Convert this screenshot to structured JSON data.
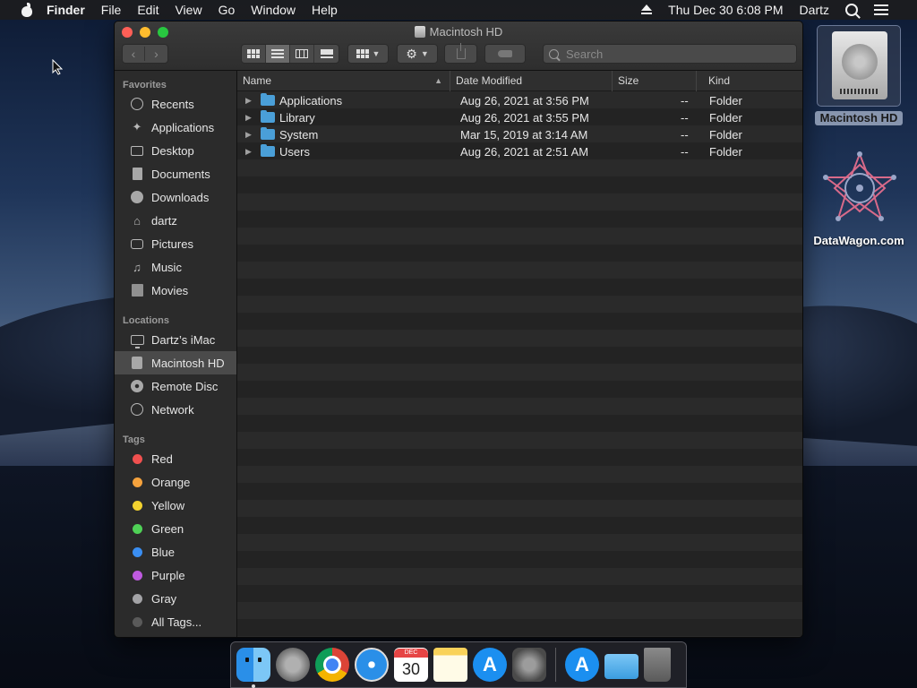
{
  "menubar": {
    "app_name": "Finder",
    "items": [
      "File",
      "Edit",
      "View",
      "Go",
      "Window",
      "Help"
    ],
    "datetime": "Thu Dec 30  6:08 PM",
    "user": "Dartz"
  },
  "window": {
    "title": "Macintosh HD",
    "search_placeholder": "Search"
  },
  "sidebar": {
    "favorites_heading": "Favorites",
    "favorites": [
      {
        "label": "Recents",
        "icon": "clock-icon"
      },
      {
        "label": "Applications",
        "icon": "applications-icon"
      },
      {
        "label": "Desktop",
        "icon": "desktop-icon"
      },
      {
        "label": "Documents",
        "icon": "document-icon"
      },
      {
        "label": "Downloads",
        "icon": "download-icon"
      },
      {
        "label": "dartz",
        "icon": "home-icon"
      },
      {
        "label": "Pictures",
        "icon": "camera-icon"
      },
      {
        "label": "Music",
        "icon": "music-icon"
      },
      {
        "label": "Movies",
        "icon": "film-icon"
      }
    ],
    "locations_heading": "Locations",
    "locations": [
      {
        "label": "Dartz’s iMac",
        "icon": "imac-icon"
      },
      {
        "label": "Macintosh HD",
        "icon": "hard-drive-icon",
        "selected": true
      },
      {
        "label": "Remote Disc",
        "icon": "disc-icon"
      },
      {
        "label": "Network",
        "icon": "globe-icon"
      }
    ],
    "tags_heading": "Tags",
    "tags": [
      {
        "label": "Red",
        "color": "#f0504f"
      },
      {
        "label": "Orange",
        "color": "#f5a23d"
      },
      {
        "label": "Yellow",
        "color": "#f3d22f"
      },
      {
        "label": "Green",
        "color": "#4fd156"
      },
      {
        "label": "Blue",
        "color": "#3a8ef2"
      },
      {
        "label": "Purple",
        "color": "#bf5ae0"
      },
      {
        "label": "Gray",
        "color": "#a3a3a6"
      },
      {
        "label": "All Tags...",
        "color": "#5a5a5a"
      }
    ]
  },
  "columns": {
    "name": "Name",
    "date": "Date Modified",
    "size": "Size",
    "kind": "Kind"
  },
  "files": [
    {
      "name": "Applications",
      "date": "Aug 26, 2021 at 3:56 PM",
      "size": "--",
      "kind": "Folder"
    },
    {
      "name": "Library",
      "date": "Aug 26, 2021 at 3:55 PM",
      "size": "--",
      "kind": "Folder"
    },
    {
      "name": "System",
      "date": "Mar 15, 2019 at 3:14 AM",
      "size": "--",
      "kind": "Folder"
    },
    {
      "name": "Users",
      "date": "Aug 26, 2021 at 2:51 AM",
      "size": "--",
      "kind": "Folder"
    }
  ],
  "desktop": {
    "hd_label": "Macintosh HD",
    "logo_label": "DataWagon.com"
  },
  "dock": {
    "calendar_month": "DEC",
    "calendar_day": "30"
  }
}
